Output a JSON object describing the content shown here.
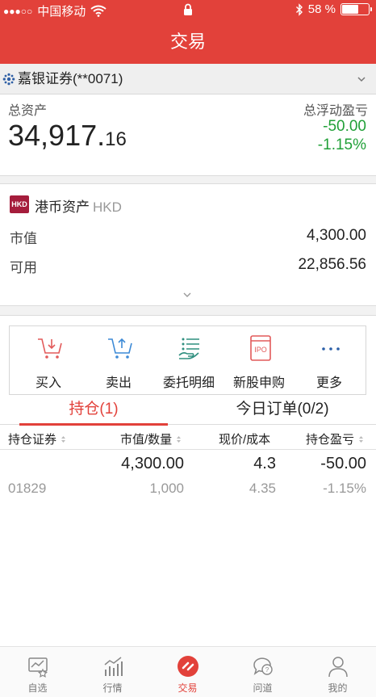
{
  "status_bar": {
    "signal": "●●●○○",
    "carrier": "中国移动",
    "battery_text": "58 %",
    "battery_level": 0.58
  },
  "header": {
    "title": "交易"
  },
  "account": {
    "name": "嘉银证券(**0071)"
  },
  "summary": {
    "total_label": "总资产",
    "total_main": "34,917.",
    "total_decimal": "16",
    "float_pl_label": "总浮动盈亏",
    "float_pl_value": "-50.00",
    "float_pl_percent": "-1.15%"
  },
  "hkd_assets": {
    "badge": "HKD",
    "title": "港币资产",
    "currency": "HKD",
    "market_value_label": "市值",
    "market_value": "4,300.00",
    "available_label": "可用",
    "available": "22,856.56"
  },
  "actions": [
    {
      "label": "买入",
      "icon": "buy-cart-icon"
    },
    {
      "label": "卖出",
      "icon": "sell-cart-icon"
    },
    {
      "label": "委托明细",
      "icon": "order-details-icon"
    },
    {
      "label": "新股申购",
      "icon": "ipo-icon"
    },
    {
      "label": "更多",
      "icon": "more-icon"
    }
  ],
  "tabs": {
    "positions": "持仓(1)",
    "orders": "今日订单(0/2)"
  },
  "table_headers": {
    "security": "持仓证券",
    "value_qty": "市值/数量",
    "price_cost": "现价/成本",
    "pl": "持仓盈亏"
  },
  "positions": [
    {
      "name": "",
      "market_value": "4,300.00",
      "price": "4.3",
      "pl": "-50.00",
      "code": "01829",
      "quantity": "1,000",
      "cost": "4.35",
      "pl_percent": "-1.15%"
    }
  ],
  "tab_bar": [
    {
      "label": "自选",
      "icon": "watchlist-icon"
    },
    {
      "label": "行情",
      "icon": "market-icon"
    },
    {
      "label": "交易",
      "icon": "trade-icon"
    },
    {
      "label": "问道",
      "icon": "qa-icon"
    },
    {
      "label": "我的",
      "icon": "profile-icon"
    }
  ],
  "colors": {
    "brand_red": "#e2413a",
    "loss_green": "#21a038",
    "hkd_badge": "#a51d3c",
    "action_red": "#e25a5a",
    "action_blue": "#3d8ad6",
    "action_teal": "#2f8f7f",
    "action_navy": "#2b5fa8"
  }
}
